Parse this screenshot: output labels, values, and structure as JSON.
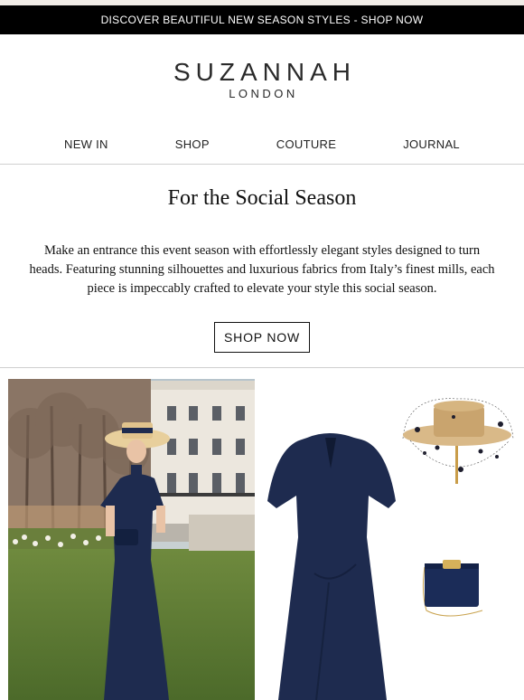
{
  "announcement": {
    "text": "DISCOVER BEAUTIFUL NEW SEASON STYLES - SHOP NOW"
  },
  "brand": {
    "name": "SUZANNAH",
    "subtitle": "LONDON"
  },
  "nav": {
    "items": [
      "NEW IN",
      "SHOP",
      "COUTURE",
      "JOURNAL"
    ]
  },
  "hero": {
    "title": "For the Social Season",
    "body": "Make an entrance this event season with effortlessly elegant styles designed to turn heads. Featuring stunning silhouettes and luxurious fabrics from Italy’s finest mills, each piece is impeccably crafted to elevate your style this social season.",
    "cta_label": "SHOP NOW"
  },
  "colors": {
    "announcement_bg": "#000000",
    "navy_dress": "#1e2b4f",
    "straw_hat": "#d9b988",
    "divider": "#cfcfcf"
  }
}
